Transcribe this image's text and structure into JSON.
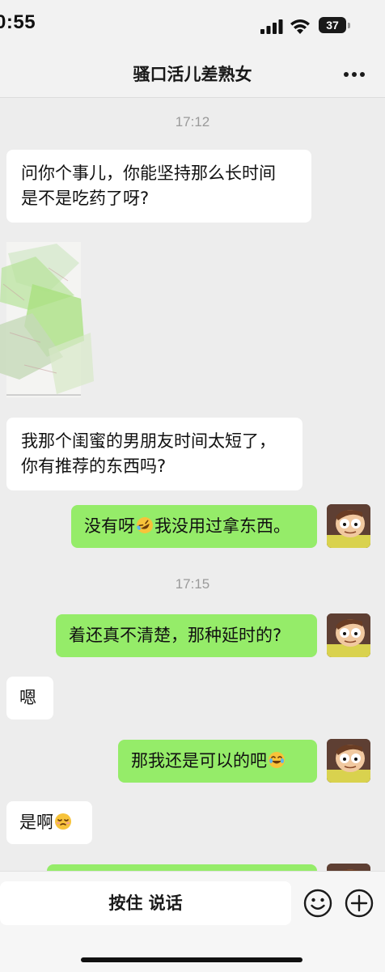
{
  "status_bar": {
    "time": "0:55",
    "battery": "37"
  },
  "nav": {
    "title": "骚口活儿差熟女"
  },
  "chat": {
    "timestamps": [
      "17:12",
      "17:15"
    ],
    "messages": [
      {
        "side": "in",
        "text": "问你个事儿，你能坚持那么长时间\n是不是吃药了呀?"
      },
      {
        "side": "in",
        "text": "我那个闺蜜的男朋友时间太短了，\n你有推荐的东西吗?"
      },
      {
        "side": "out",
        "text_before": "没有呀",
        "emoji": "rolling-laugh",
        "text_after": "我没用过拿东西。"
      },
      {
        "side": "out",
        "text": "着还真不清楚，那种延时的?"
      },
      {
        "side": "in",
        "text": "嗯"
      },
      {
        "side": "out",
        "text_before": "那我还是可以的吧",
        "emoji": "tears-of-joy",
        "text_after": ""
      },
      {
        "side": "in",
        "text_before": "是啊",
        "emoji": "sweat-smile",
        "text_after": ""
      }
    ]
  },
  "input_bar": {
    "hold_to_talk": "按住 说话",
    "emoji_button_icon": "smiley-icon",
    "plus_button_icon": "plus-circle-icon"
  },
  "colors": {
    "background": "#ededed",
    "incoming_bubble": "#ffffff",
    "outgoing_bubble": "#95ec69",
    "timestamp": "#9a9a9a"
  }
}
